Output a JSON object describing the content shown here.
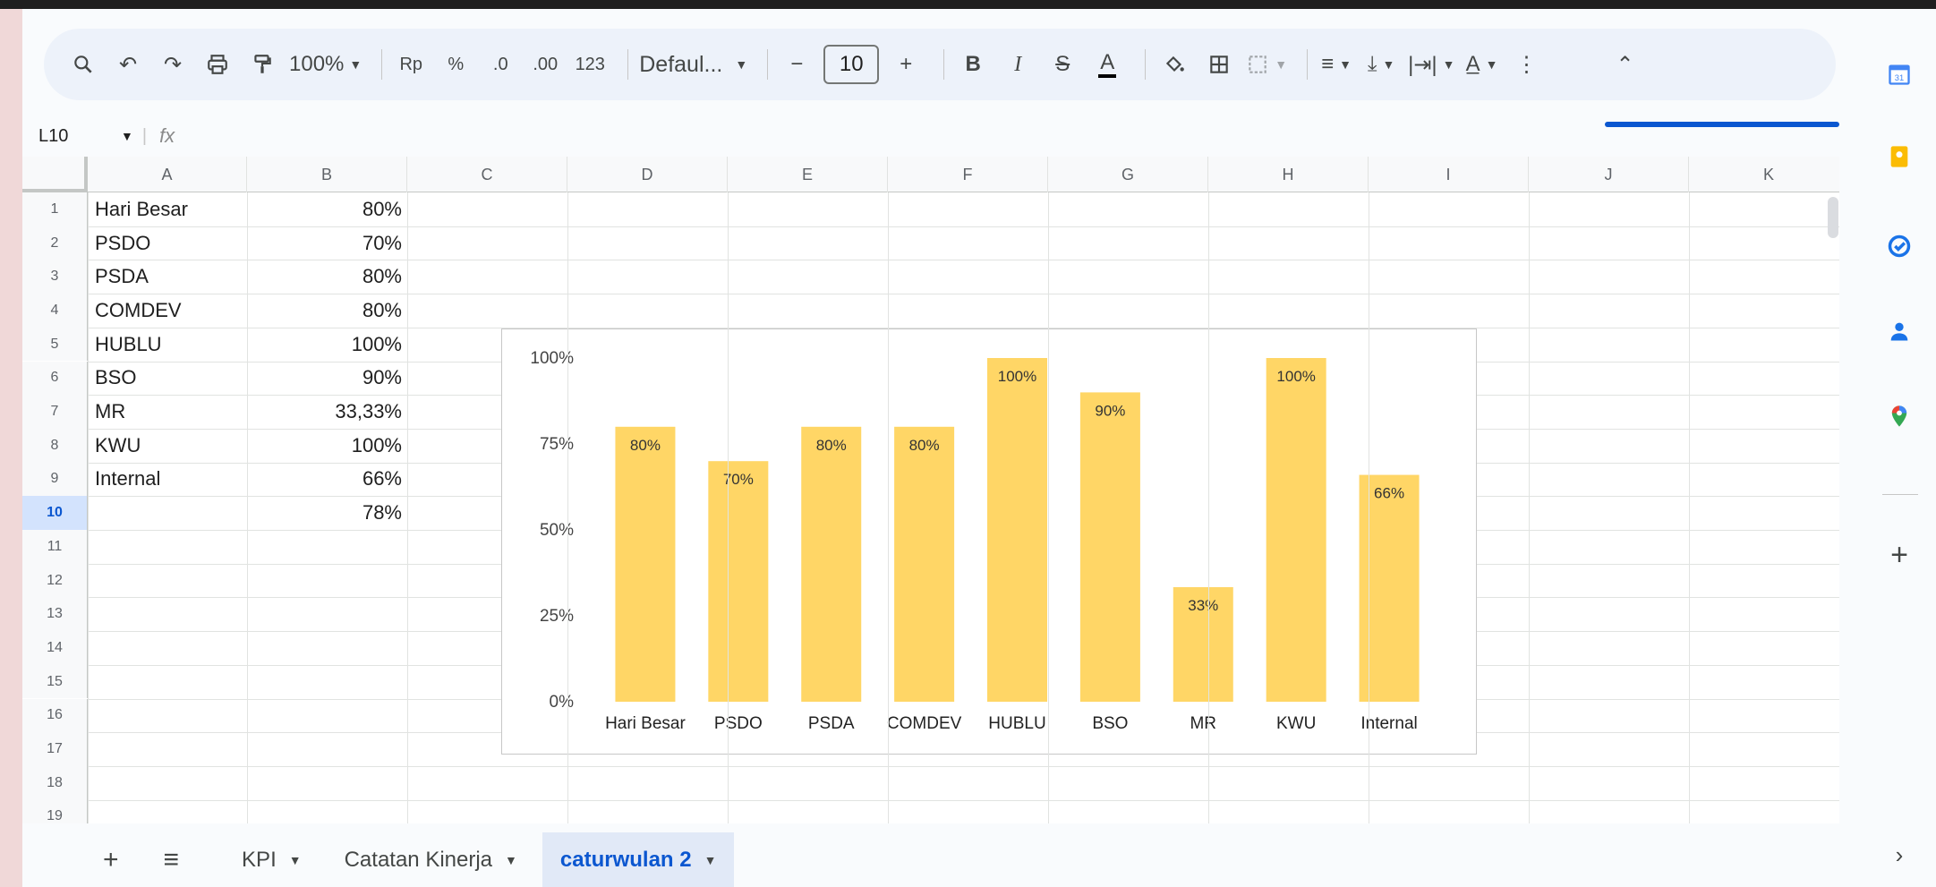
{
  "toolbar": {
    "zoom": "100%",
    "currency": "Rp",
    "percent": "%",
    "dec_decrease": ".0",
    "dec_increase": ".00",
    "more_formats": "123",
    "font": "Defaul...",
    "font_size": "10",
    "bold": "B",
    "italic": "I",
    "text_color": "A"
  },
  "formula_bar": {
    "cell_ref": "L10",
    "fx": "fx"
  },
  "columns": [
    "A",
    "B",
    "C",
    "D",
    "E",
    "F",
    "G",
    "H",
    "I",
    "J",
    "K"
  ],
  "rows": [
    "1",
    "2",
    "3",
    "4",
    "5",
    "6",
    "7",
    "8",
    "9",
    "10",
    "11",
    "12",
    "13",
    "14",
    "15",
    "16",
    "17",
    "18",
    "19"
  ],
  "cells": {
    "a": [
      "Hari Besar",
      "PSDO",
      "PSDA",
      "COMDEV",
      "HUBLU",
      "BSO",
      "MR",
      "KWU",
      "Internal",
      ""
    ],
    "b": [
      "80%",
      "70%",
      "80%",
      "80%",
      "100%",
      "90%",
      "33,33%",
      "100%",
      "66%",
      "78%"
    ]
  },
  "chart_data": {
    "type": "bar",
    "categories": [
      "Hari Besar",
      "PSDO",
      "PSDA",
      "COMDEV",
      "HUBLU",
      "BSO",
      "MR",
      "KWU",
      "Internal"
    ],
    "values": [
      80,
      70,
      80,
      80,
      100,
      90,
      33.33,
      100,
      66
    ],
    "data_labels": [
      "80%",
      "70%",
      "80%",
      "80%",
      "100%",
      "90%",
      "33%",
      "100%",
      "66%"
    ],
    "yticks": [
      "0%",
      "25%",
      "50%",
      "75%",
      "100%"
    ],
    "ylim": [
      0,
      100
    ],
    "bar_color": "#ffd666",
    "grid": false,
    "legend": "none"
  },
  "sheets": [
    {
      "label": "KPI",
      "active": false
    },
    {
      "label": "Catatan Kinerja",
      "active": false
    },
    {
      "label": "caturwulan 2",
      "active": true
    }
  ],
  "colors": {
    "accent": "#0b57d0",
    "toolbar_bg": "#edf2fa",
    "bar": "#ffd666"
  }
}
